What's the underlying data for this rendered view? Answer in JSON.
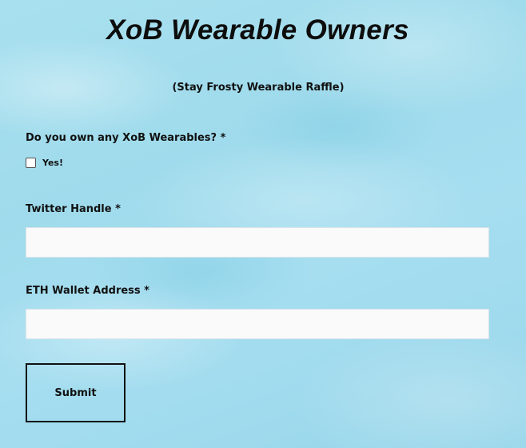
{
  "header": {
    "title": "XoB Wearable Owners",
    "subtitle": "(Stay Frosty Wearable Raffle)"
  },
  "form": {
    "own_question": {
      "label": "Do you own any XoB Wearables? *",
      "option_label": "Yes!",
      "checked": false
    },
    "twitter": {
      "label": "Twitter Handle *",
      "value": "",
      "placeholder": ""
    },
    "eth_wallet": {
      "label": "ETH Wallet Address *",
      "value": "",
      "placeholder": ""
    },
    "submit_label": "Submit"
  },
  "colors": {
    "background": "#a6def0",
    "text": "#111111",
    "input_background": "#fafafa"
  }
}
